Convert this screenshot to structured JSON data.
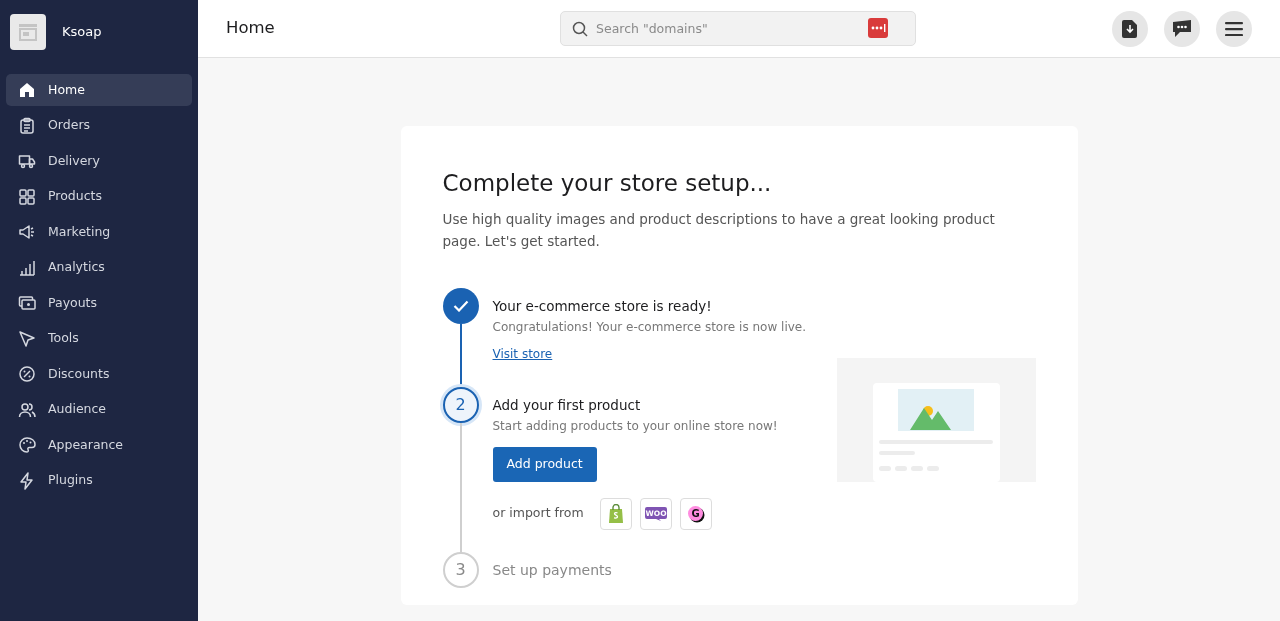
{
  "store": {
    "name": "Ksoap"
  },
  "sidebar": {
    "items": [
      {
        "label": "Home",
        "selected": true
      },
      {
        "label": "Orders",
        "selected": false
      },
      {
        "label": "Delivery",
        "selected": false
      },
      {
        "label": "Products",
        "selected": false
      },
      {
        "label": "Marketing",
        "selected": false
      },
      {
        "label": "Analytics",
        "selected": false
      },
      {
        "label": "Payouts",
        "selected": false
      },
      {
        "label": "Tools",
        "selected": false
      },
      {
        "label": "Discounts",
        "selected": false
      },
      {
        "label": "Audience",
        "selected": false
      },
      {
        "label": "Appearance",
        "selected": false
      },
      {
        "label": "Plugins",
        "selected": false
      }
    ]
  },
  "header": {
    "title": "Home",
    "search": {
      "placeholder": "Search \"domains\""
    }
  },
  "setup": {
    "title": "Complete your store setup...",
    "description": "Use high quality images and product descriptions to have a great looking product page. Let's get started.",
    "steps": [
      {
        "completed": true,
        "active": false,
        "title": "Your e-commerce store is ready!",
        "text": "Congratulations! Your e-commerce store is now live.",
        "link": "Visit store"
      },
      {
        "number": "2",
        "completed": false,
        "active": true,
        "title": "Add your first product",
        "text": "Start adding products to your online store now!",
        "button": "Add product",
        "import_label": "or import from",
        "import_sources": [
          {
            "kind": "shopify"
          },
          {
            "kind": "woo",
            "logo_text": "WOO"
          },
          {
            "kind": "g",
            "logo_text": "G"
          }
        ]
      },
      {
        "number": "3",
        "completed": false,
        "active": false,
        "title": "Set up payments"
      }
    ]
  }
}
